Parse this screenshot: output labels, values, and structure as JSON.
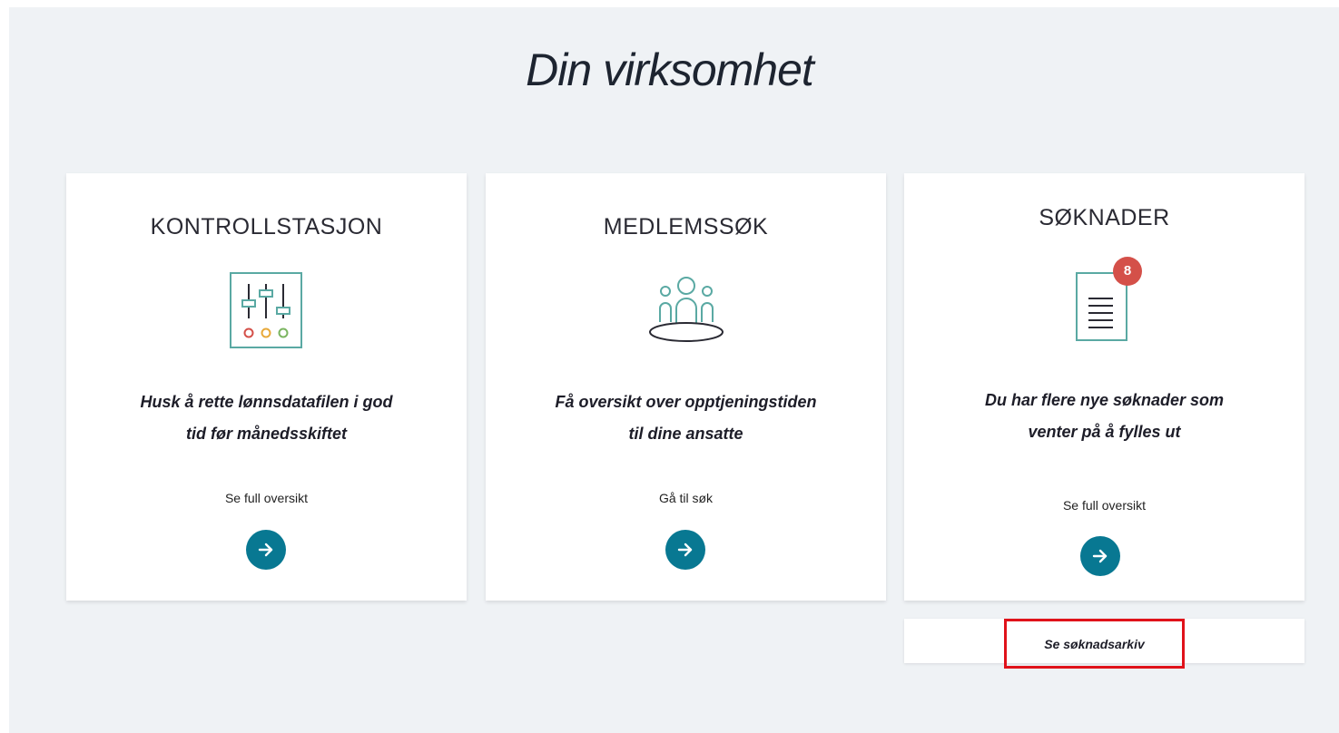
{
  "page": {
    "title": "Din virksomhet"
  },
  "cards": [
    {
      "title": "KONTROLLSTASJON",
      "icon": "control-panel-sliders-icon",
      "text_line1": "Husk å rette lønnsdatafilen i god",
      "text_line2": "tid før månedsskiftet",
      "link": "Se full oversikt"
    },
    {
      "title": "MEDLEMSSØK",
      "icon": "people-group-icon",
      "text_line1": "Få oversikt over opptjeningstiden",
      "text_line2": "til dine ansatte",
      "link": "Gå til søk"
    },
    {
      "title": "SØKNADER",
      "icon": "document-icon",
      "badge": "8",
      "text_line1": "Du har flere nye søknader som",
      "text_line2": "venter på å fylles ut",
      "link": "Se full oversikt"
    }
  ],
  "archive": {
    "link": "Se søknadsarkiv"
  },
  "colors": {
    "background": "#eff2f5",
    "card": "#ffffff",
    "accent": "#087892",
    "badge": "#d45049",
    "icon_teal": "#5aa9a3",
    "highlight_border": "#e0121a"
  }
}
